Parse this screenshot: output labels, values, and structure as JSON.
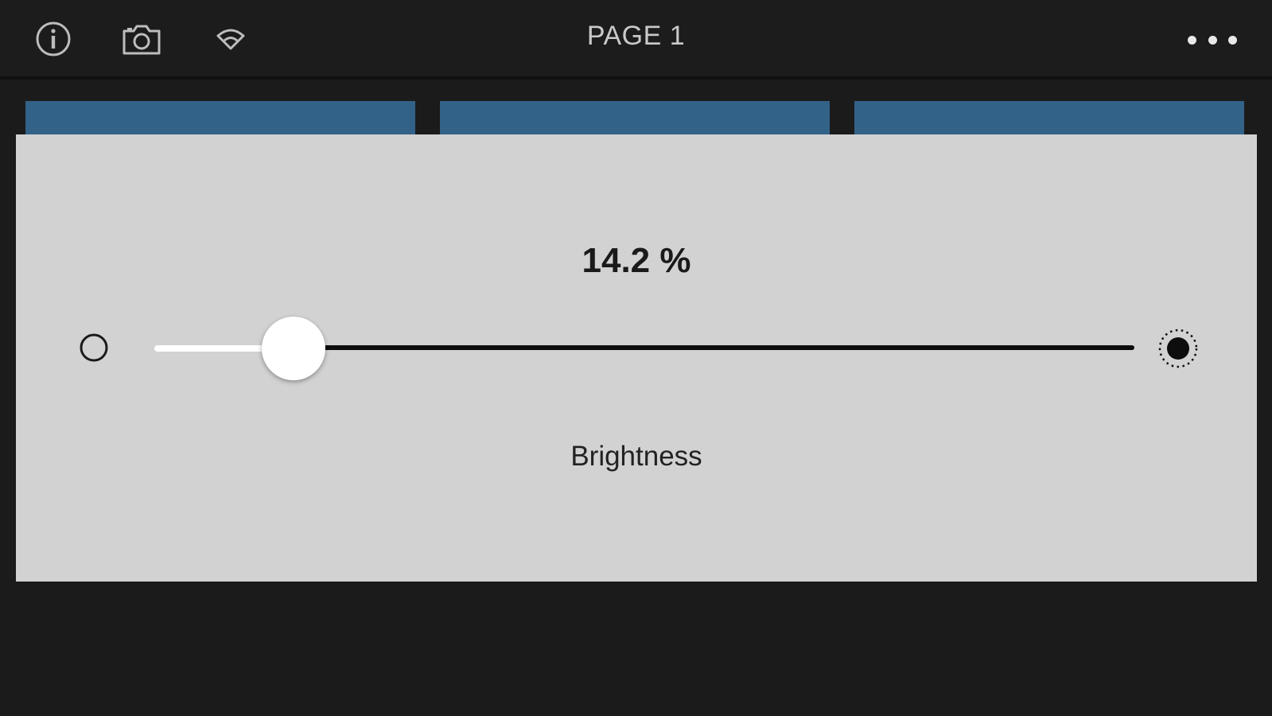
{
  "header": {
    "title": "PAGE 1",
    "icons": [
      "info-icon",
      "camera-icon",
      "wifi-icon",
      "more-icon"
    ]
  },
  "tabs": [
    {
      "label": ""
    },
    {
      "label": ""
    },
    {
      "label": ""
    }
  ],
  "panel": {
    "value_text": "14.2 %",
    "caption": "Brightness",
    "slider_value_percent": 14.2,
    "min_icon": "brightness-low-icon",
    "max_icon": "brightness-high-icon"
  },
  "colors": {
    "background": "#1b1b1b",
    "tab": "#336289",
    "panel": "#d2d2d2",
    "thumb": "#ffffff"
  }
}
